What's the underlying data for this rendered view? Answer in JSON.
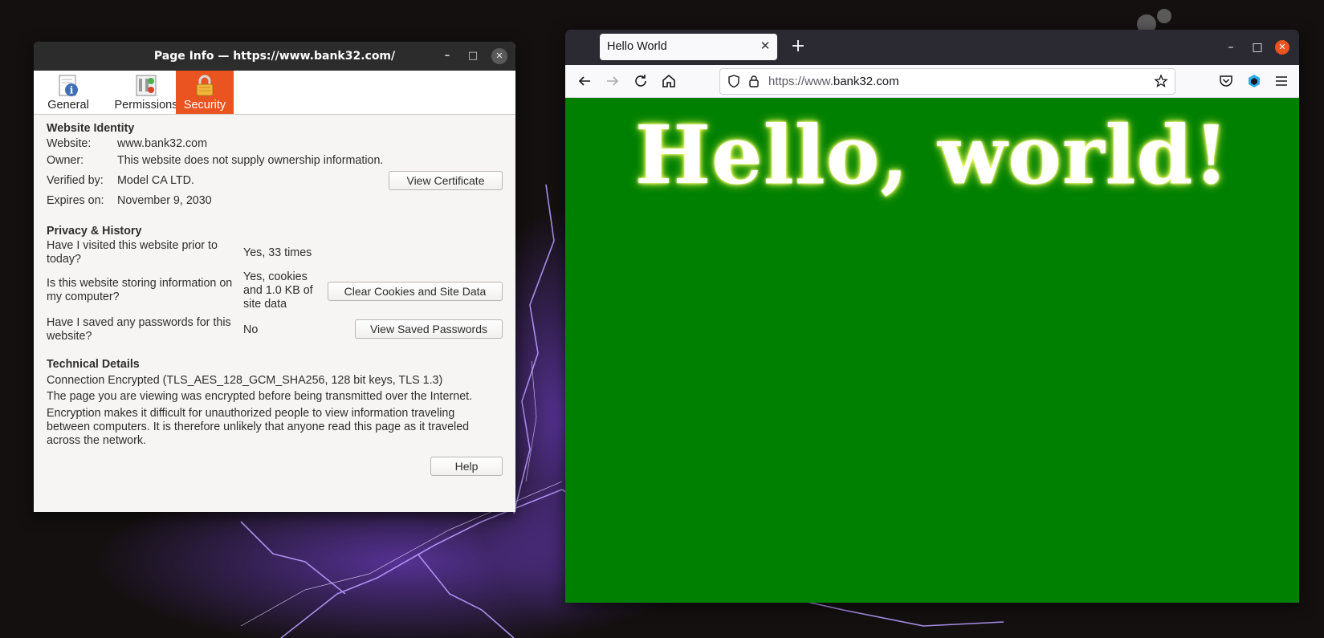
{
  "desktop": {
    "wallpaper": "purple-lightning"
  },
  "page_info": {
    "title": "Page Info — https://www.bank32.com/",
    "window_buttons": {
      "minimize": "–",
      "maximize": "□",
      "close": "✕"
    },
    "tabs": [
      {
        "label": "General",
        "icon": "info-page-icon"
      },
      {
        "label": "Permissions",
        "icon": "permissions-icon"
      },
      {
        "label": "Security",
        "icon": "padlock-icon",
        "selected": true
      }
    ],
    "website_identity": {
      "heading": "Website Identity",
      "website_label": "Website:",
      "website_value": "www.bank32.com",
      "owner_label": "Owner:",
      "owner_value": "This website does not supply ownership information.",
      "verified_label": "Verified by:",
      "verified_value": "Model CA LTD.",
      "view_cert_button": "View Certificate",
      "expires_label": "Expires on:",
      "expires_value": "November 9, 2030"
    },
    "privacy": {
      "heading": "Privacy & History",
      "visited_q": "Have I visited this website prior to today?",
      "visited_a": "Yes, 33 times",
      "storing_q": "Is this website storing information on my computer?",
      "storing_a": "Yes, cookies and 1.0 KB of site data",
      "clear_button": "Clear Cookies and Site Data",
      "passwords_q": "Have I saved any passwords for this website?",
      "passwords_a": "No",
      "view_passwords_button": "View Saved Passwords"
    },
    "technical": {
      "heading": "Technical Details",
      "line1": "Connection Encrypted (TLS_AES_128_GCM_SHA256, 128 bit keys, TLS 1.3)",
      "line2": "The page you are viewing was encrypted before being transmitted over the Internet.",
      "line3": "Encryption makes it difficult for unauthorized people to view information traveling between computers. It is therefore unlikely that anyone read this page as it traveled across the network."
    },
    "help_button": "Help",
    "accent_color": "#e95420"
  },
  "browser": {
    "tab_title": "Hello World",
    "tab_close": "✕",
    "new_tab": "+",
    "window_buttons": {
      "minimize": "–",
      "maximize": "□",
      "close": "✕"
    },
    "url_prefix": "https://www.",
    "url_domain": "bank32.com",
    "page_heading": "Hello, world!",
    "page_background": "#008000"
  }
}
